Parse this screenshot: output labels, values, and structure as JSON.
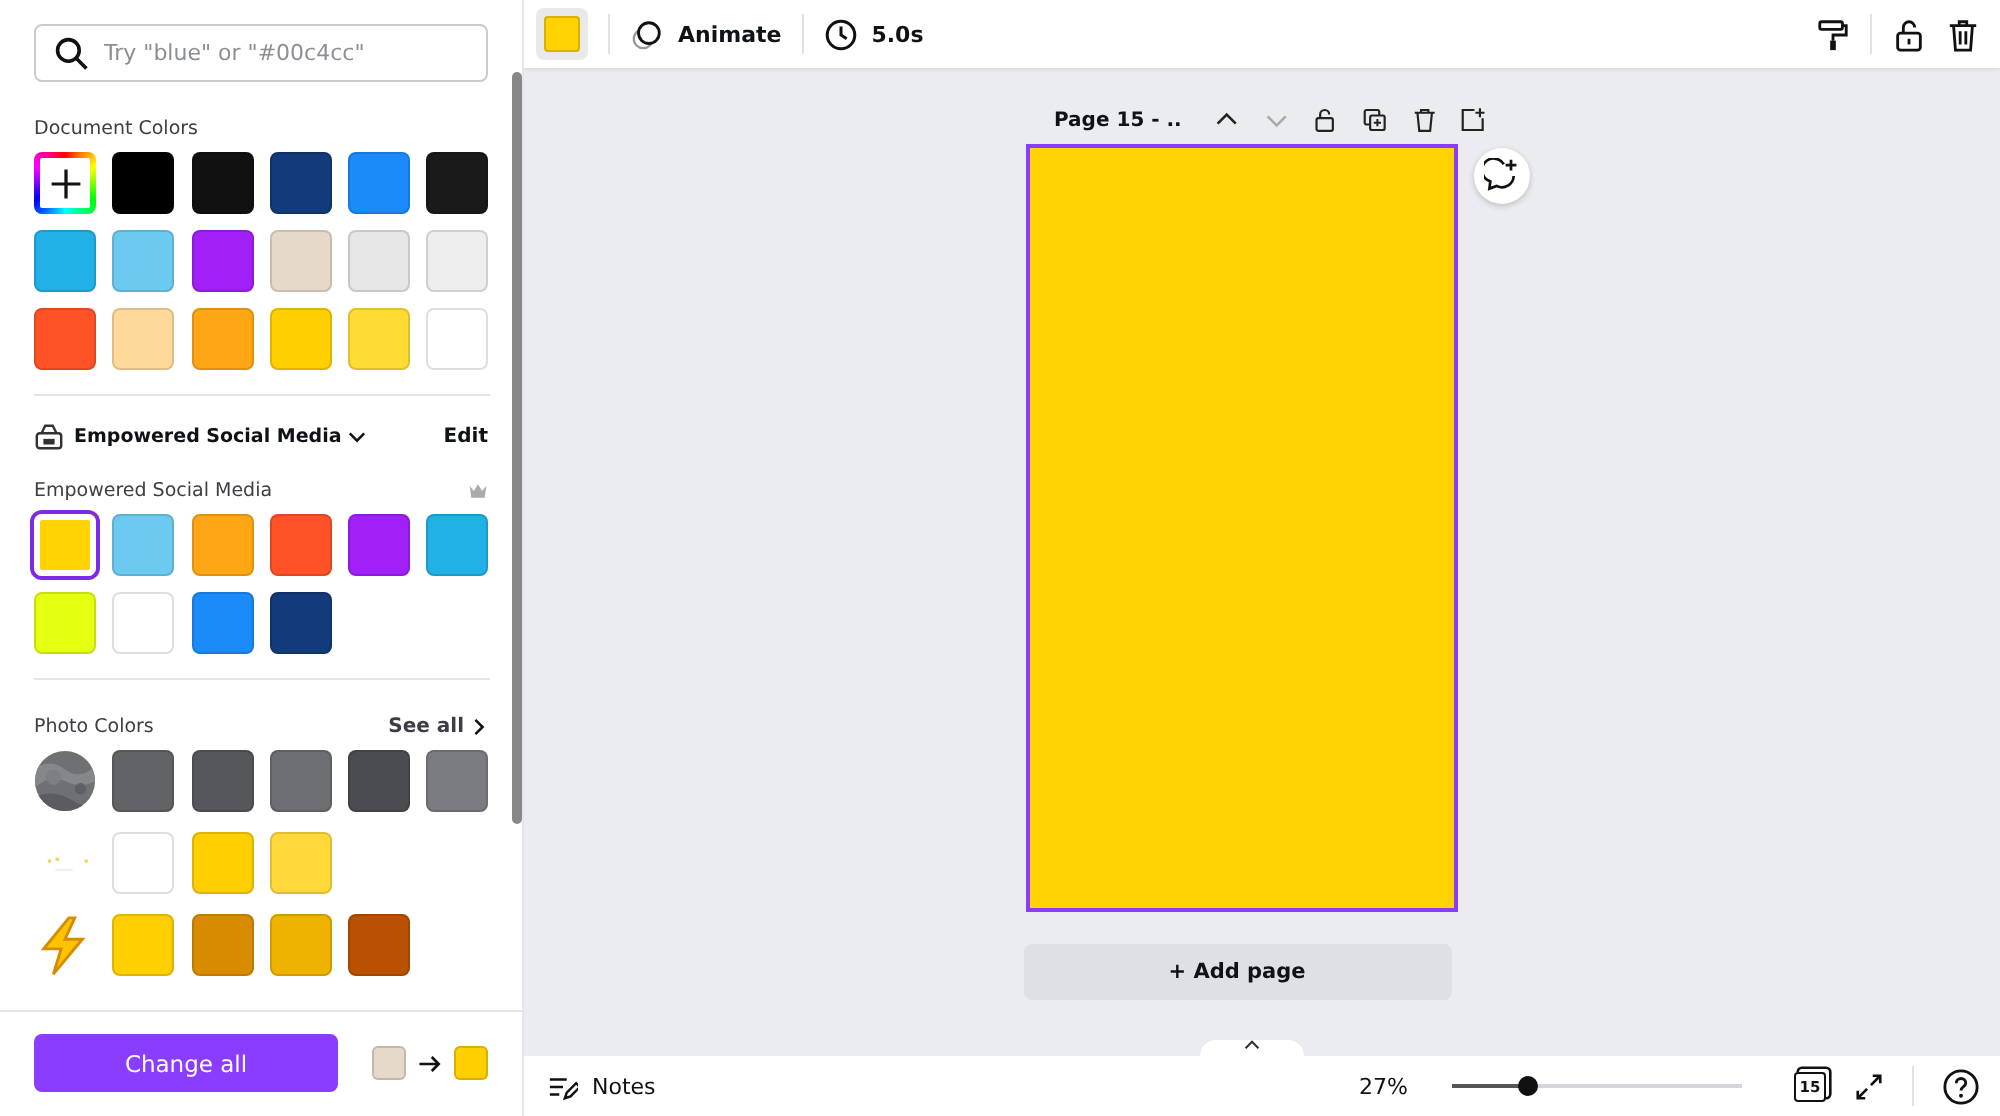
{
  "search": {
    "placeholder": "Try \"blue\" or \"#00c4cc\""
  },
  "document_colors": {
    "title": "Document Colors",
    "swatches": [
      {
        "color": "#000000"
      },
      {
        "color": "#111111"
      },
      {
        "color": "#133a7a"
      },
      {
        "color": "#1b8bfa"
      },
      {
        "color": "#1a1a1a"
      },
      {
        "color": "#22b1e6"
      },
      {
        "color": "#6ccaf0"
      },
      {
        "color": "#a020f7"
      },
      {
        "color": "#e6d9c9"
      },
      {
        "color": "#e6e6e6"
      },
      {
        "color": "#eeeeee"
      },
      {
        "color": "#ff5226"
      },
      {
        "color": "#ffd99a"
      },
      {
        "color": "#ffa614"
      },
      {
        "color": "#ffcf00"
      },
      {
        "color": "#ffdc33"
      },
      {
        "color": "#ffffff"
      }
    ]
  },
  "brand_kit": {
    "name": "Empowered Social Media",
    "edit": "Edit",
    "palette_title": "Empowered Social Media",
    "swatches": [
      {
        "color": "#ffd200",
        "selected": true
      },
      {
        "color": "#6ccaf0",
        "selected": false
      },
      {
        "color": "#ffa614",
        "selected": false
      },
      {
        "color": "#ff5226",
        "selected": false
      },
      {
        "color": "#a020f7",
        "selected": false
      },
      {
        "color": "#22b1e6",
        "selected": false
      },
      {
        "color": "#e5ff10",
        "selected": false
      },
      {
        "color": "#ffffff",
        "selected": false
      },
      {
        "color": "#1b8bfa",
        "selected": false
      },
      {
        "color": "#133a7a",
        "selected": false
      }
    ]
  },
  "photo_colors": {
    "title": "Photo Colors",
    "see_all": "See all",
    "rows": [
      {
        "swatches": [
          {
            "color": "#616366"
          },
          {
            "color": "#55575a"
          },
          {
            "color": "#6c6e71"
          },
          {
            "color": "#4a4c4f"
          },
          {
            "color": "#7a7c7f"
          }
        ]
      },
      {
        "kind": "sparkle",
        "swatches": [
          {
            "color": "#ffffff"
          },
          {
            "color": "#ffcf00"
          },
          {
            "color": "#ffd93a"
          }
        ]
      },
      {
        "kind": "lightning",
        "swatches": [
          {
            "color": "#ffcf00"
          },
          {
            "color": "#d98b00"
          },
          {
            "color": "#edb300"
          },
          {
            "color": "#b95100"
          }
        ]
      }
    ]
  },
  "footer": {
    "button": "Change all",
    "from": {
      "color": "#e6d9c9"
    },
    "to": {
      "color": "#ffcf00"
    }
  },
  "toolbar": {
    "current": {
      "color": "#ffd200"
    },
    "animate": "Animate",
    "duration": "5.0s"
  },
  "page": {
    "title": "Page 15 - ..",
    "fill": {
      "color": "#ffd200"
    },
    "selected": true,
    "add_page": "+ Add page"
  },
  "bottom_bar": {
    "notes": "Notes",
    "zoom": "27%",
    "zoom_level": {
      "level": 0.26
    },
    "page_count": "15"
  }
}
